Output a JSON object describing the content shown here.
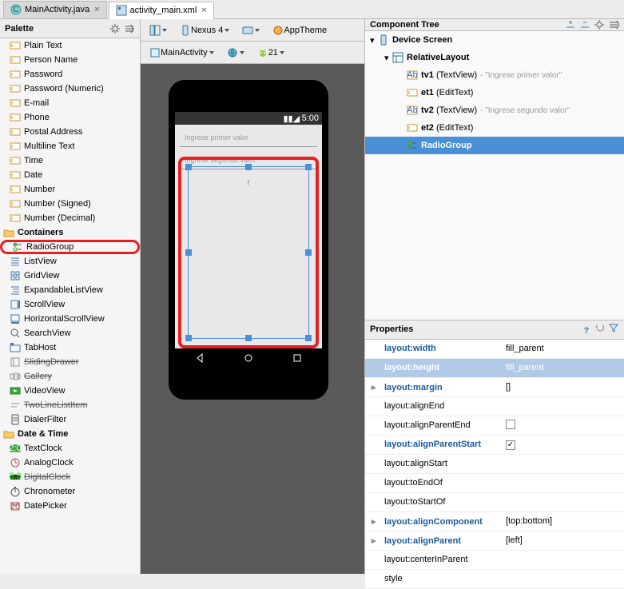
{
  "tabs": [
    {
      "label": "MainActivity.java",
      "icon": "C",
      "active": false
    },
    {
      "label": "activity_main.xml",
      "icon": "xml",
      "active": true
    }
  ],
  "palette": {
    "title": "Palette",
    "text_items": [
      "Plain Text",
      "Person Name",
      "Password",
      "Password (Numeric)",
      "E-mail",
      "Phone",
      "Postal Address",
      "Multiline Text",
      "Time",
      "Date",
      "Number",
      "Number (Signed)",
      "Number (Decimal)"
    ],
    "containers_label": "Containers",
    "containers": [
      {
        "label": "RadioGroup",
        "highlighted": true
      },
      {
        "label": "ListView"
      },
      {
        "label": "GridView"
      },
      {
        "label": "ExpandableListView"
      },
      {
        "label": "ScrollView"
      },
      {
        "label": "HorizontalScrollView"
      },
      {
        "label": "SearchView"
      },
      {
        "label": "TabHost"
      },
      {
        "label": "SlidingDrawer",
        "strike": true
      },
      {
        "label": "Gallery",
        "strike": true
      },
      {
        "label": "VideoView"
      },
      {
        "label": "TwoLineListItem",
        "strike": true
      },
      {
        "label": "DialerFilter"
      }
    ],
    "datetime_label": "Date & Time",
    "datetime": [
      {
        "label": "TextClock"
      },
      {
        "label": "AnalogClock"
      },
      {
        "label": "DigitalClock",
        "strike": true
      },
      {
        "label": "Chronometer"
      },
      {
        "label": "DatePicker"
      }
    ]
  },
  "design_toolbar": {
    "device": "Nexus 4",
    "theme": "AppTheme",
    "activity": "MainActivity",
    "api": "21"
  },
  "phone": {
    "time": "5:00",
    "hint1": "Ingrese primer valor",
    "hint2": "Ingrese segundo valor"
  },
  "tree": {
    "title": "Component Tree",
    "nodes": [
      {
        "level": 0,
        "caret": "▾",
        "icon": "device",
        "label": "Device Screen"
      },
      {
        "level": 1,
        "caret": "▾",
        "icon": "layout",
        "label": "RelativeLayout"
      },
      {
        "level": 2,
        "caret": "",
        "icon": "ab",
        "label": "tv1 ",
        "type": "(TextView)",
        "hint": "- \"Ingrese primer valor\""
      },
      {
        "level": 2,
        "caret": "",
        "icon": "edit",
        "label": "et1 ",
        "type": "(EditText)"
      },
      {
        "level": 2,
        "caret": "",
        "icon": "ab",
        "label": "tv2 ",
        "type": "(TextView)",
        "hint": "- \"Ingrese segundo valor\""
      },
      {
        "level": 2,
        "caret": "",
        "icon": "edit",
        "label": "et2 ",
        "type": "(EditText)"
      },
      {
        "level": 2,
        "caret": "",
        "icon": "radio",
        "label": "RadioGroup",
        "selected": true
      }
    ]
  },
  "properties": {
    "title": "Properties",
    "rows": [
      {
        "key": "layout:width",
        "val": "fill_parent",
        "blue": true
      },
      {
        "key": "layout:height",
        "val": "fill_parent",
        "sel": true
      },
      {
        "key": "layout:margin",
        "val": "[]",
        "blue": true,
        "exp": "▸"
      },
      {
        "key": "layout:alignEnd",
        "val": ""
      },
      {
        "key": "layout:alignParentEnd",
        "val": "",
        "checkbox": true,
        "checked": false
      },
      {
        "key": "layout:alignParentStart",
        "val": "",
        "checkbox": true,
        "checked": true,
        "blue": true
      },
      {
        "key": "layout:alignStart",
        "val": ""
      },
      {
        "key": "layout:toEndOf",
        "val": ""
      },
      {
        "key": "layout:toStartOf",
        "val": ""
      },
      {
        "key": "layout:alignComponent",
        "val": "[top:bottom]",
        "blue": true,
        "exp": "▸"
      },
      {
        "key": "layout:alignParent",
        "val": "[left]",
        "blue": true,
        "exp": "▸"
      },
      {
        "key": "layout:centerInParent",
        "val": ""
      },
      {
        "key": "style",
        "val": ""
      }
    ]
  }
}
